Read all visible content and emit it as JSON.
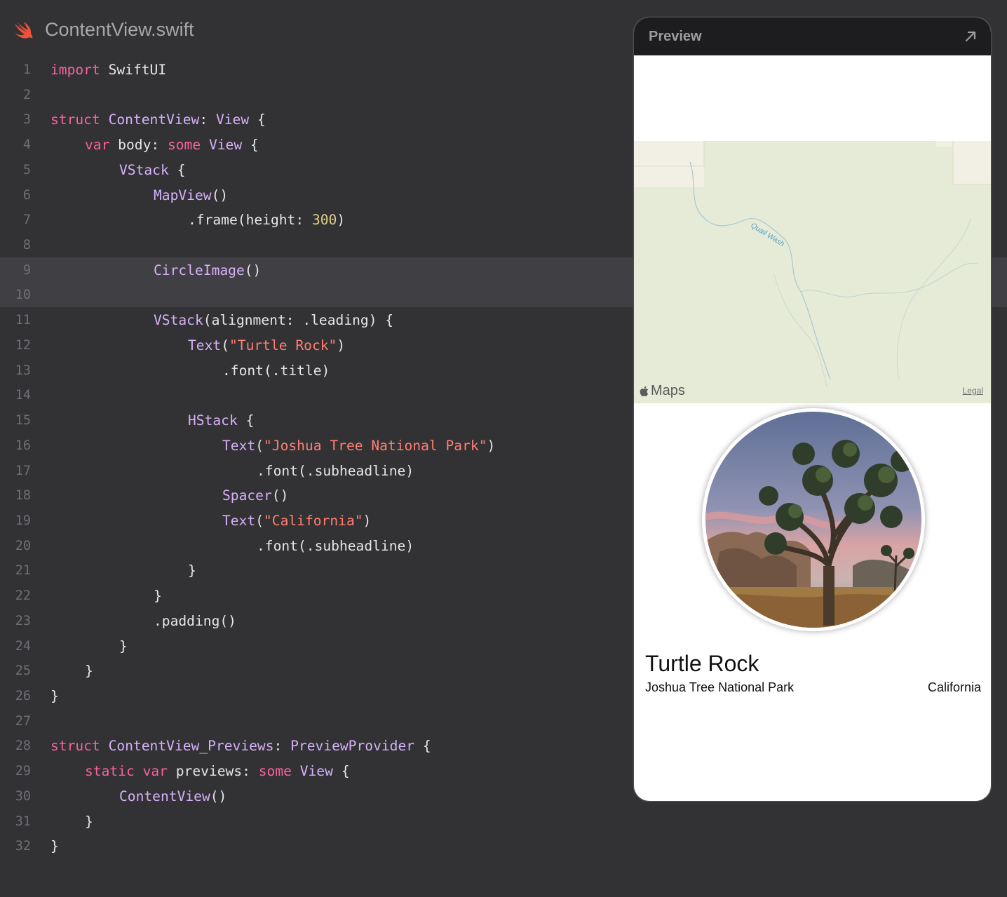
{
  "editor": {
    "file_name": "ContentView.swift",
    "highlighted_lines": [
      9,
      10
    ],
    "lines": [
      {
        "n": "1",
        "indent": 0,
        "tokens": [
          [
            "kw",
            "import"
          ],
          [
            "pl",
            " SwiftUI"
          ]
        ]
      },
      {
        "n": "2",
        "indent": 0,
        "tokens": []
      },
      {
        "n": "3",
        "indent": 0,
        "tokens": [
          [
            "kw",
            "struct"
          ],
          [
            "pl",
            " "
          ],
          [
            "ty",
            "ContentView"
          ],
          [
            "pl",
            ": "
          ],
          [
            "ty",
            "View"
          ],
          [
            "pl",
            " {"
          ]
        ]
      },
      {
        "n": "4",
        "indent": 1,
        "tokens": [
          [
            "kw",
            "var"
          ],
          [
            "pl",
            " body: "
          ],
          [
            "kw",
            "some"
          ],
          [
            "pl",
            " "
          ],
          [
            "ty",
            "View"
          ],
          [
            "pl",
            " {"
          ]
        ]
      },
      {
        "n": "5",
        "indent": 2,
        "tokens": [
          [
            "ty",
            "VStack"
          ],
          [
            "pl",
            " {"
          ]
        ]
      },
      {
        "n": "6",
        "indent": 3,
        "tokens": [
          [
            "ty",
            "MapView"
          ],
          [
            "pl",
            "()"
          ]
        ]
      },
      {
        "n": "7",
        "indent": 4,
        "tokens": [
          [
            "pl",
            ".frame(height: "
          ],
          [
            "nu",
            "300"
          ],
          [
            "pl",
            ")"
          ]
        ]
      },
      {
        "n": "8",
        "indent": 0,
        "tokens": []
      },
      {
        "n": "9",
        "indent": 3,
        "tokens": [
          [
            "ty",
            "CircleImage"
          ],
          [
            "pl",
            "()"
          ]
        ]
      },
      {
        "n": "10",
        "indent": 0,
        "tokens": []
      },
      {
        "n": "11",
        "indent": 3,
        "tokens": [
          [
            "ty",
            "VStack"
          ],
          [
            "pl",
            "(alignment: .leading) {"
          ]
        ]
      },
      {
        "n": "12",
        "indent": 4,
        "tokens": [
          [
            "ty",
            "Text"
          ],
          [
            "pl",
            "("
          ],
          [
            "st",
            "\"Turtle Rock\""
          ],
          [
            "pl",
            ")"
          ]
        ]
      },
      {
        "n": "13",
        "indent": 5,
        "tokens": [
          [
            "pl",
            ".font(.title)"
          ]
        ]
      },
      {
        "n": "14",
        "indent": 0,
        "tokens": []
      },
      {
        "n": "15",
        "indent": 4,
        "tokens": [
          [
            "ty",
            "HStack"
          ],
          [
            "pl",
            " {"
          ]
        ]
      },
      {
        "n": "16",
        "indent": 5,
        "tokens": [
          [
            "ty",
            "Text"
          ],
          [
            "pl",
            "("
          ],
          [
            "st",
            "\"Joshua Tree National Park\""
          ],
          [
            "pl",
            ")"
          ]
        ]
      },
      {
        "n": "17",
        "indent": 6,
        "tokens": [
          [
            "pl",
            ".font(.subheadline)"
          ]
        ]
      },
      {
        "n": "18",
        "indent": 5,
        "tokens": [
          [
            "ty",
            "Spacer"
          ],
          [
            "pl",
            "()"
          ]
        ]
      },
      {
        "n": "19",
        "indent": 5,
        "tokens": [
          [
            "ty",
            "Text"
          ],
          [
            "pl",
            "("
          ],
          [
            "st",
            "\"California\""
          ],
          [
            "pl",
            ")"
          ]
        ]
      },
      {
        "n": "20",
        "indent": 6,
        "tokens": [
          [
            "pl",
            ".font(.subheadline)"
          ]
        ]
      },
      {
        "n": "21",
        "indent": 4,
        "tokens": [
          [
            "pl",
            "}"
          ]
        ]
      },
      {
        "n": "22",
        "indent": 3,
        "tokens": [
          [
            "pl",
            "}"
          ]
        ]
      },
      {
        "n": "23",
        "indent": 3,
        "tokens": [
          [
            "pl",
            ".padding()"
          ]
        ]
      },
      {
        "n": "24",
        "indent": 2,
        "tokens": [
          [
            "pl",
            "}"
          ]
        ]
      },
      {
        "n": "25",
        "indent": 1,
        "tokens": [
          [
            "pl",
            "}"
          ]
        ]
      },
      {
        "n": "26",
        "indent": 0,
        "tokens": [
          [
            "pl",
            "}"
          ]
        ]
      },
      {
        "n": "27",
        "indent": 0,
        "tokens": []
      },
      {
        "n": "28",
        "indent": 0,
        "tokens": [
          [
            "kw",
            "struct"
          ],
          [
            "pl",
            " "
          ],
          [
            "ty",
            "ContentView_Previews"
          ],
          [
            "pl",
            ": "
          ],
          [
            "ty",
            "PreviewProvider"
          ],
          [
            "pl",
            " {"
          ]
        ]
      },
      {
        "n": "29",
        "indent": 1,
        "tokens": [
          [
            "kw",
            "static"
          ],
          [
            "pl",
            " "
          ],
          [
            "kw",
            "var"
          ],
          [
            "pl",
            " previews: "
          ],
          [
            "kw",
            "some"
          ],
          [
            "pl",
            " "
          ],
          [
            "ty",
            "View"
          ],
          [
            "pl",
            " {"
          ]
        ]
      },
      {
        "n": "30",
        "indent": 2,
        "tokens": [
          [
            "ty",
            "ContentView"
          ],
          [
            "pl",
            "()"
          ]
        ]
      },
      {
        "n": "31",
        "indent": 1,
        "tokens": [
          [
            "pl",
            "}"
          ]
        ]
      },
      {
        "n": "32",
        "indent": 0,
        "tokens": [
          [
            "pl",
            "}"
          ]
        ]
      }
    ]
  },
  "preview": {
    "title": "Preview",
    "expand_icon": "arrow-up-right-icon",
    "map": {
      "water_label": "Quail Wash",
      "attribution": "Maps",
      "legal": "Legal"
    },
    "place": {
      "title": "Turtle Rock",
      "park": "Joshua Tree National Park",
      "state": "California"
    }
  },
  "colors": {
    "background": "#323235",
    "keyword": "#f9629b",
    "type": "#d7b0f9",
    "string": "#ff7f72",
    "number": "#dfcf8a"
  }
}
